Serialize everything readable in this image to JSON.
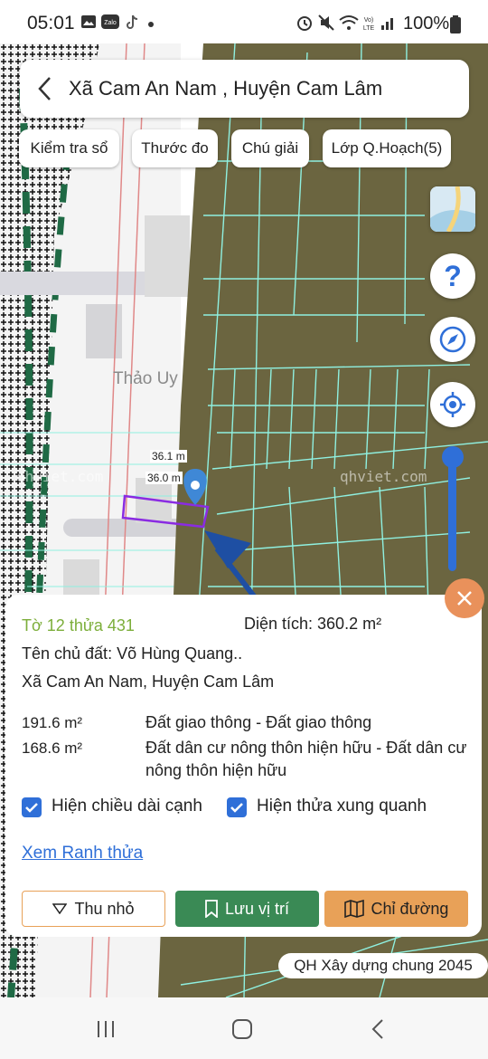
{
  "status_bar": {
    "time": "05:01",
    "battery": "100%",
    "network_label": "Vo) LTE",
    "icons": [
      "gallery-icon",
      "zalo-icon",
      "tiktok-icon",
      "dot-icon",
      "alarm-icon",
      "mute-icon",
      "wifi-icon",
      "volte-icon",
      "signal-icon",
      "battery-icon"
    ]
  },
  "header": {
    "title": "Xã Cam An Nam , Huyện Cam Lâm"
  },
  "toolbar": {
    "check_book": "Kiểm tra sổ",
    "measure": "Thước đo",
    "legend": "Chú giải",
    "planning_layer": "Lớp Q.Hoạch(5)"
  },
  "map": {
    "place_label": "Thảo Uy",
    "watermark_left": "qhviet.com",
    "watermark_right": "qhviet.com",
    "edge_label_top": "36.1 m",
    "edge_label_bottom": "36.0 m",
    "land_color": "#6b6540",
    "parcel_line_color": "#8ff0e0",
    "highlight_color": "#8a2be2"
  },
  "info": {
    "parcel_id": "Tờ 12 thửa 431",
    "area_label": "Diện tích: 360.2 m²",
    "owner": "Tên chủ đất: Võ Hùng Quang..",
    "address": "Xã Cam An Nam, Huyện Cam Lâm",
    "uses": [
      {
        "area": "191.6 m²",
        "desc": "Đất giao thông - Đất giao thông"
      },
      {
        "area": "168.6 m²",
        "desc": "Đất dân cư nông thôn hiện hữu - Đất dân cư nông thôn hiện hữu"
      }
    ],
    "show_edge_length": "Hiện chiều dài cạnh",
    "show_neighbors": "Hiện thửa xung quanh",
    "view_boundary": "Xem Ranh thửa",
    "minimize": "Thu nhỏ",
    "save_location": "Lưu vị trí",
    "directions": "Chỉ đường"
  },
  "plan_badge": "QH Xây dựng chung 2045",
  "colors": {
    "accent": "#2f6fd8",
    "green": "#3a8a55",
    "orange": "#e8a158",
    "parcel_green_text": "#7cae3a"
  }
}
